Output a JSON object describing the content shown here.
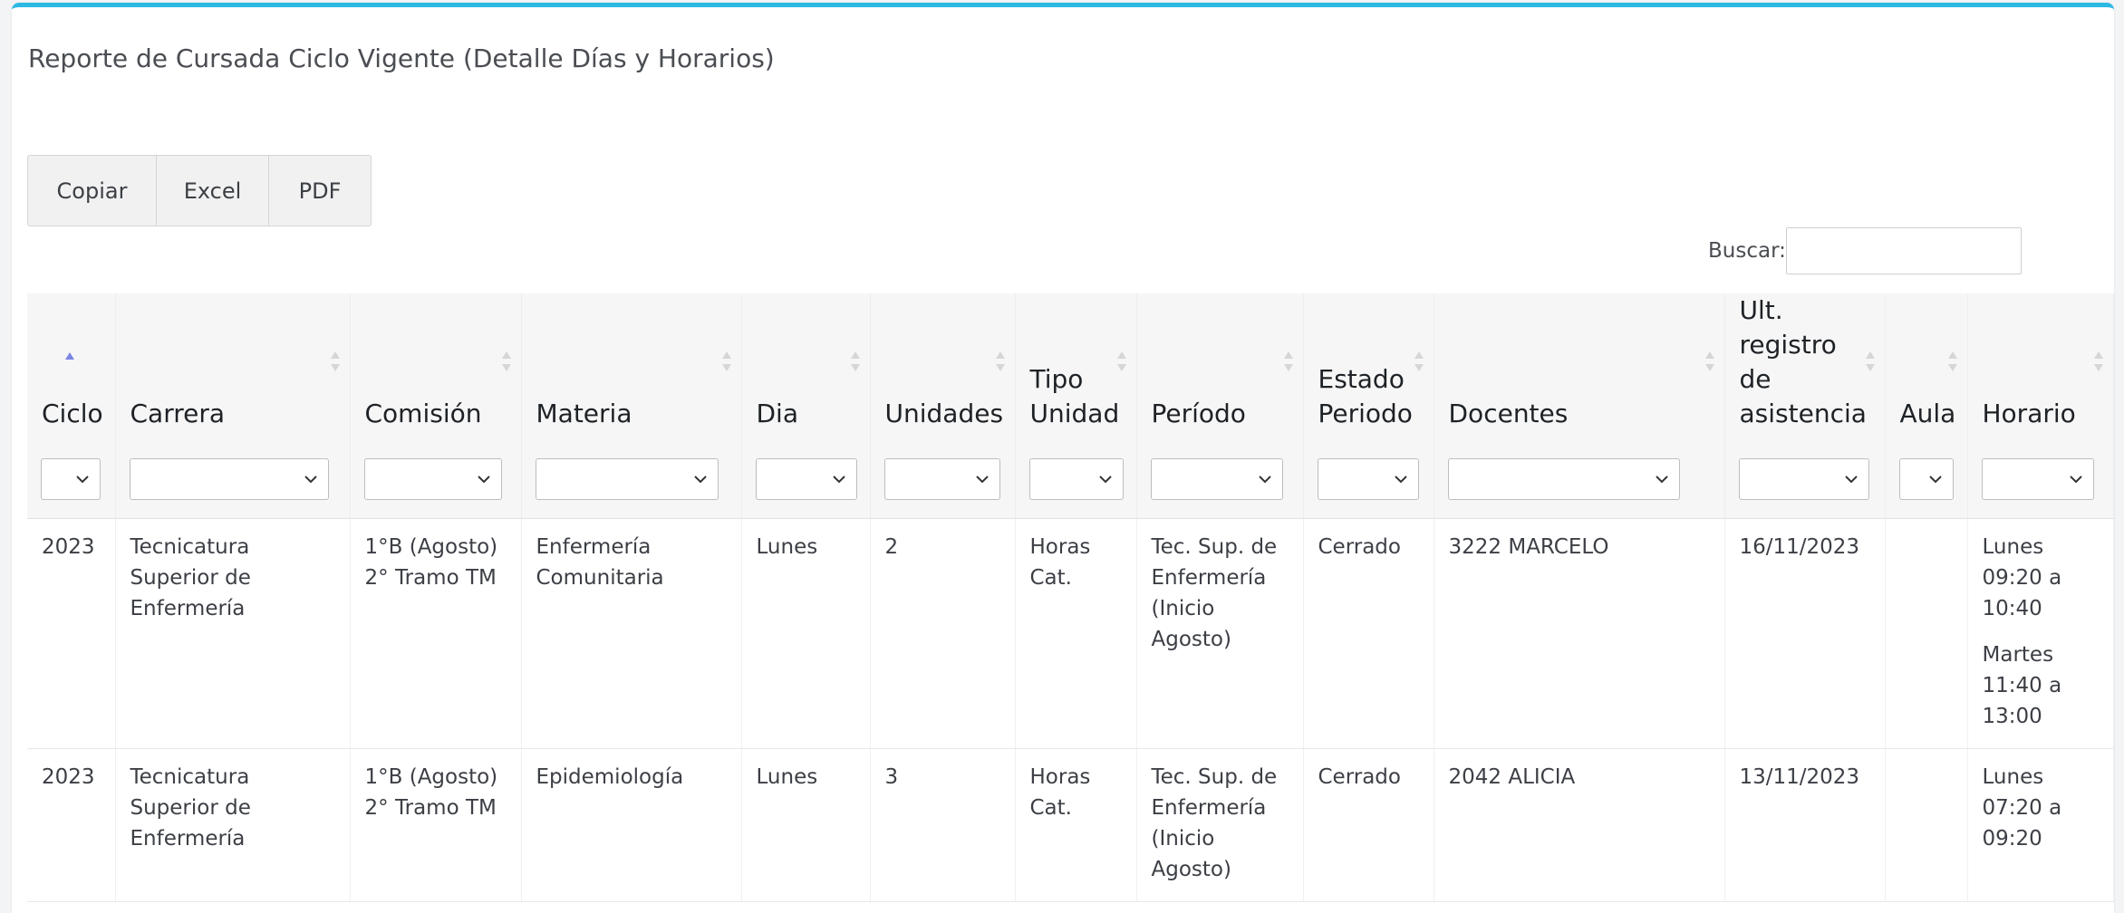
{
  "page": {
    "title": "Reporte de Cursada Ciclo Vigente (Detalle Días y Horarios)",
    "accent_color": "#2cb9e3"
  },
  "toolbar": {
    "copy_label": "Copiar",
    "excel_label": "Excel",
    "pdf_label": "PDF"
  },
  "search": {
    "label": "Buscar:",
    "value": "",
    "placeholder": ""
  },
  "table": {
    "columns": [
      {
        "label": "Ciclo",
        "sort": "asc"
      },
      {
        "label": "Carrera",
        "sort": "none"
      },
      {
        "label": "Comisión",
        "sort": "none"
      },
      {
        "label": "Materia",
        "sort": "none"
      },
      {
        "label": "Dia",
        "sort": "none"
      },
      {
        "label": "Unidades",
        "sort": "none"
      },
      {
        "label": "Tipo Unidad",
        "sort": "none"
      },
      {
        "label": "Período",
        "sort": "none"
      },
      {
        "label": "Estado Periodo",
        "sort": "none"
      },
      {
        "label": "Docentes",
        "sort": "none"
      },
      {
        "label": "Ult. registro de asistencia",
        "sort": "none"
      },
      {
        "label": "Aula",
        "sort": "none"
      },
      {
        "label": "Horario",
        "sort": "none"
      }
    ],
    "rows": [
      {
        "ciclo": "2023",
        "carrera": "Tecnicatura Superior de Enfermería",
        "comision": [
          "1°B (Agosto)",
          "2° Tramo TM"
        ],
        "materia": "Enfermería Comunitaria",
        "dia": "Lunes",
        "unidades": "2",
        "tipo_unidad": "Horas Cat.",
        "periodo": "Tec. Sup. de Enfermería (Inicio Agosto)",
        "estado_periodo": "Cerrado",
        "docentes": "3222 MARCELO",
        "ult_registro": "16/11/2023",
        "aula": "",
        "horario": [
          [
            "Lunes",
            "09:20 a",
            "10:40"
          ],
          [
            "Martes",
            "11:40 a",
            "13:00"
          ]
        ]
      },
      {
        "ciclo": "2023",
        "carrera": "Tecnicatura Superior de Enfermería",
        "comision": [
          "1°B (Agosto)",
          "2° Tramo TM"
        ],
        "materia": "Epidemiología",
        "dia": "Lunes",
        "unidades": "3",
        "tipo_unidad": "Horas Cat.",
        "periodo": "Tec. Sup. de Enfermería (Inicio Agosto)",
        "estado_periodo": "Cerrado",
        "docentes": "2042 ALICIA",
        "ult_registro": "13/11/2023",
        "aula": "",
        "horario": [
          [
            "Lunes",
            "07:20 a",
            "09:20"
          ]
        ]
      }
    ]
  }
}
